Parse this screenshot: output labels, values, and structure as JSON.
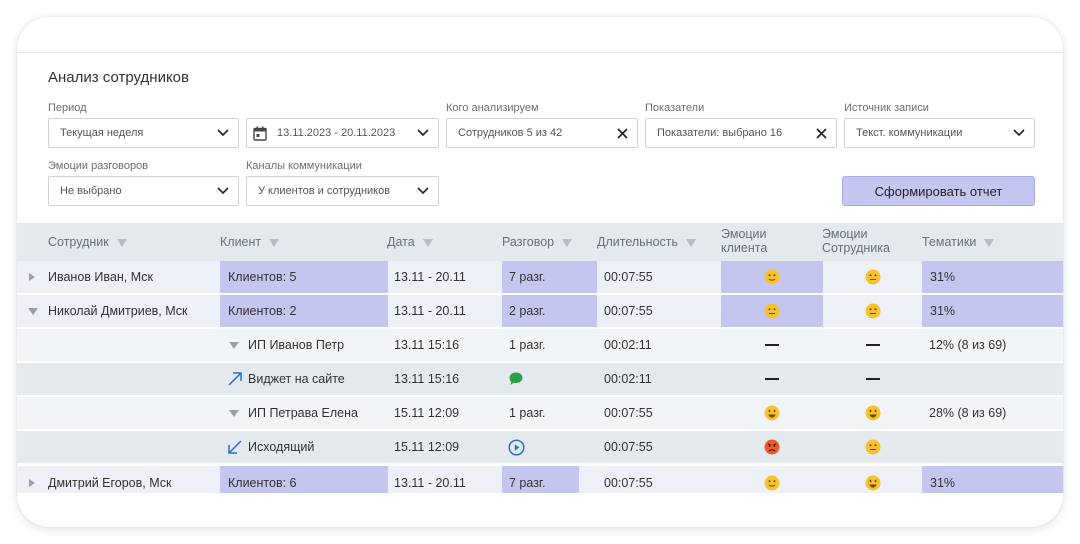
{
  "page": {
    "title": "Анализ сотрудников"
  },
  "filters": {
    "period": {
      "label": "Период",
      "value": "Текущая неделя"
    },
    "dates": {
      "value": "13.11.2023 - 20.11.2023"
    },
    "who": {
      "label": "Кого анализируем",
      "value": "Сотрудников 5 из 42"
    },
    "metrics": {
      "label": "Показатели",
      "value": "Показатели: выбрано 16"
    },
    "source": {
      "label": "Источник записи",
      "value": "Текст. коммуникации"
    },
    "emotions": {
      "label": "Эмоции разговоров",
      "value": "Не выбрано"
    },
    "channels": {
      "label": "Каналы коммуникации",
      "value": "У клиентов и сотрудников"
    }
  },
  "actions": {
    "report_label": "Сформировать отчет"
  },
  "table": {
    "headers": {
      "employee": "Сотрудник",
      "client": "Клиент",
      "date": "Дата",
      "talk": "Разговор",
      "duration": "Длительность",
      "emo_client_1": "Эмоции",
      "emo_client_2": "клиента",
      "emo_staff_1": "Эмоции",
      "emo_staff_2": "Сотрудника",
      "topics": "Тематики"
    },
    "rows": [
      {
        "employee": "Иванов Иван, Мск",
        "client": "Клиентов: 5",
        "date": "13.11 - 20.11",
        "talk": "7 разг.",
        "duration": "00:07:55",
        "emo_client": "smile-slight",
        "emo_staff": "smile-neutral",
        "topics": "31%"
      },
      {
        "employee": "Николай Дмитриев, Мск",
        "client": "Клиентов: 2",
        "date": "13.11 - 20.11",
        "talk": "2 разг.",
        "duration": "00:07:55",
        "emo_client": "smile-neutral",
        "emo_staff": "smile-neutral",
        "topics": "31%"
      },
      {
        "client": "ИП Иванов Петр",
        "date": "13.11  15:16",
        "talk": "1 разг.",
        "duration": "00:02:11",
        "topics": "12% (8 из 69)"
      },
      {
        "client": "Виджет на сайте",
        "date": "13.11  15:16",
        "talk_icon": "chat-bubble-icon",
        "duration": "00:02:11"
      },
      {
        "client": "ИП Петрава Елена",
        "date": "15.11  12:09",
        "talk": "1 разг.",
        "duration": "00:07:55",
        "emo_client": "grin",
        "emo_staff": "grin",
        "topics": "28% (8 из 69)"
      },
      {
        "client": "Исходящий",
        "date": "15.11  12:09",
        "talk_icon": "play-circle-icon",
        "duration": "00:07:55",
        "emo_client": "angry",
        "emo_staff": "smile-neutral"
      },
      {
        "employee": "Дмитрий Егоров, Мск",
        "client": "Клиентов: 6",
        "date": "13.11 - 20.11",
        "talk": "7 разг.",
        "duration": "00:07:55",
        "emo_client": "smile-slight",
        "emo_staff": "grin",
        "topics": "31%"
      }
    ]
  },
  "colors": {
    "highlight": "#c5c6ef",
    "header_bg": "#e4e9ee",
    "accent_blue": "#2a6fd1",
    "chat_green": "#2e9d4a"
  }
}
